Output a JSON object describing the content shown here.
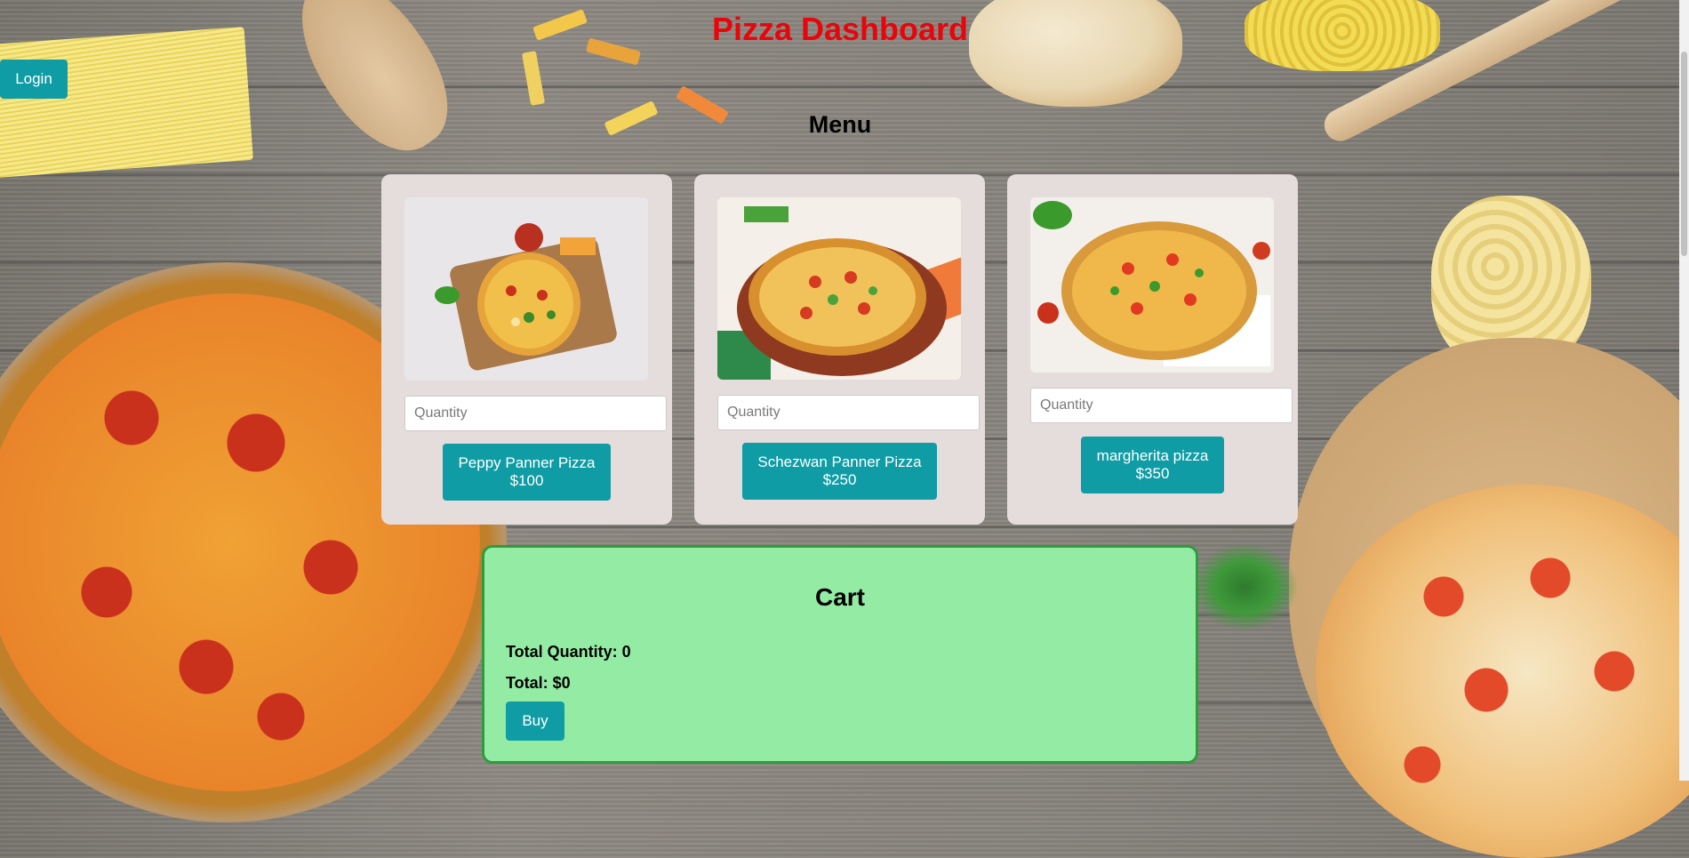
{
  "header": {
    "title": "Pizza Dashboard"
  },
  "auth": {
    "login_label": "Login"
  },
  "menu": {
    "heading": "Menu",
    "items": [
      {
        "name": "Peppy Panner Pizza",
        "price": "$100",
        "quantity_placeholder": "Quantity"
      },
      {
        "name": "Schezwan Panner Pizza",
        "price": "$250",
        "quantity_placeholder": "Quantity"
      },
      {
        "name": "margherita pizza",
        "price": "$350",
        "quantity_placeholder": "Quantity"
      }
    ]
  },
  "cart": {
    "title": "Cart",
    "total_quantity": "Total Quantity: 0",
    "total": "Total: $0",
    "buy_label": "Buy"
  },
  "colors": {
    "title": "#e8050b",
    "button": "#0f9ca5",
    "card_bg": "#e5dcdc",
    "cart_bg": "#94eca4",
    "cart_border": "#2f9b3c"
  }
}
